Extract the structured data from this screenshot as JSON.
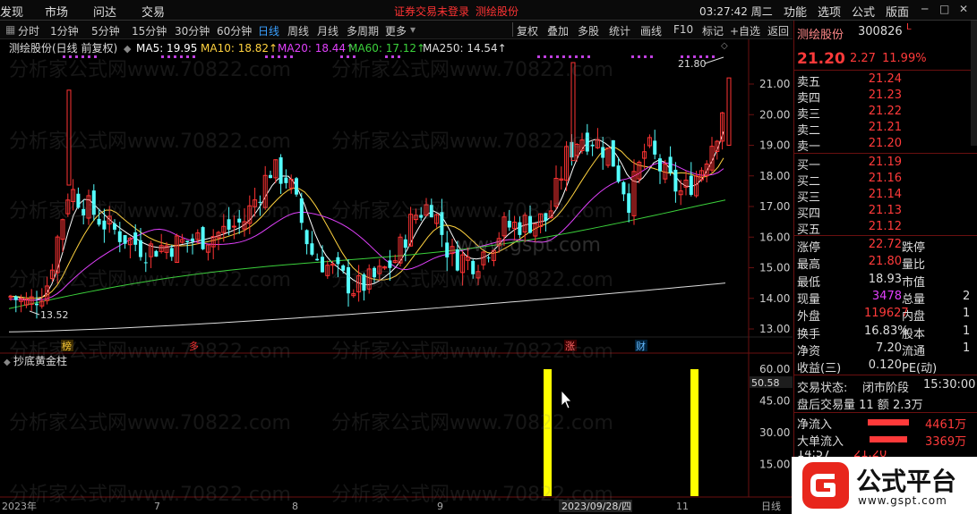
{
  "menubar": {
    "left_items": [
      "发现",
      "市场",
      "问达",
      "交易"
    ],
    "warning": "证券交易未登录",
    "stock_link": "测绘股份",
    "time": "03:27:42 周二",
    "right_items": [
      "功能",
      "选项",
      "公式",
      "版面"
    ],
    "window_controls": [
      "─",
      "□",
      "✕"
    ]
  },
  "toolbar": {
    "periods": [
      "分时",
      "1分钟",
      "5分钟",
      "15分钟",
      "30分钟",
      "60分钟",
      "日线",
      "周线",
      "月线",
      "多周期",
      "更多"
    ],
    "active_period": "日线",
    "actions": [
      "复权",
      "叠加",
      "多股",
      "统计",
      "画线",
      "F10",
      "标记",
      "+自选",
      "返回"
    ]
  },
  "chart_title": {
    "name": "测绘股份(日线 前复权)",
    "ma5": "MA5: 19.95",
    "ma10": "MA10: 18.82↑",
    "ma20": "MA20: 18.44↑",
    "ma60": "MA60: 17.12↑",
    "ma250": "MA250: 14.54↑"
  },
  "colors": {
    "up": "#ff3333",
    "down": "#54ffff",
    "ma5": "#ffffff",
    "ma10": "#ffd23f",
    "ma20": "#e040fb",
    "ma60": "#3bd13b",
    "ma250": "#dddddd",
    "indicator_bar": "#ffff00",
    "accent_blue": "#3aa0ff"
  },
  "price_axis": [
    "21.00",
    "20.00",
    "19.00",
    "18.00",
    "17.00",
    "16.00",
    "15.00",
    "14.00",
    "13.00"
  ],
  "annotations": {
    "high_label": "21.80",
    "low_label": "13.52",
    "tags": [
      "榜",
      "多",
      "涨",
      "财"
    ]
  },
  "indicator": {
    "name": "抄底黄金柱",
    "axis": [
      "60.00",
      "45.00",
      "30.00",
      "15.00"
    ],
    "current_value": "50.58"
  },
  "date_axis": [
    "2023年",
    "7",
    "8",
    "9",
    "2023/09/28/四",
    "11",
    "日线"
  ],
  "watermark": "分析家公式网www.70822.com",
  "watermark2": "www.gspt.com",
  "quote": {
    "name": "测绘股份",
    "code": "300826",
    "flag": "L",
    "price": "21.20",
    "change": "2.27",
    "change_pct": "11.99%",
    "asks": [
      {
        "label": "卖五",
        "price": "21.24"
      },
      {
        "label": "卖四",
        "price": "21.23"
      },
      {
        "label": "卖三",
        "price": "21.22"
      },
      {
        "label": "卖二",
        "price": "21.21"
      },
      {
        "label": "卖一",
        "price": "21.20"
      }
    ],
    "bids": [
      {
        "label": "买一",
        "price": "21.19"
      },
      {
        "label": "买二",
        "price": "21.16"
      },
      {
        "label": "买三",
        "price": "21.14"
      },
      {
        "label": "买四",
        "price": "21.13"
      },
      {
        "label": "买五",
        "price": "21.12"
      }
    ],
    "stats": [
      {
        "l1": "涨停",
        "v1": "22.72",
        "l2": "跌停",
        "v1_color": "#ff3a3a"
      },
      {
        "l1": "最高",
        "v1": "21.80",
        "l2": "量比",
        "v1_color": "#ff3a3a"
      },
      {
        "l1": "最低",
        "v1": "18.93",
        "l2": "市值",
        "v1_color": "#dddddd"
      },
      {
        "l1": "现量",
        "v1": "3478",
        "l2": "总量",
        "v1_color": "#e040fb",
        "v2": "2"
      },
      {
        "l1": "外盘",
        "v1": "119627",
        "l2": "内盘",
        "v1_color": "#ff3a3a",
        "v2": "1"
      },
      {
        "l1": "换手",
        "v1": "16.83%",
        "l2": "股本",
        "v1_color": "#dddddd",
        "v2": "1"
      },
      {
        "l1": "净资",
        "v1": "7.20",
        "l2": "流通",
        "v1_color": "#dddddd",
        "v2": "1"
      },
      {
        "l1": "收益(三)",
        "v1": "0.120",
        "l2": "PE(动)",
        "v1_color": "#dddddd"
      }
    ],
    "status_label": "交易状态:",
    "status_value": "闭市阶段",
    "status_time": "15:30:00",
    "after_hours": "盘后交易量 11 额 2.3万",
    "netflow_label": "净流入",
    "netflow_value": "4461万",
    "bigflow_label": "大单流入",
    "bigflow_value": "3369万",
    "tick_time": "14:57",
    "tick_price": "21.20"
  },
  "logo": {
    "text": "公式平台",
    "url": "www.gspt.com"
  }
}
